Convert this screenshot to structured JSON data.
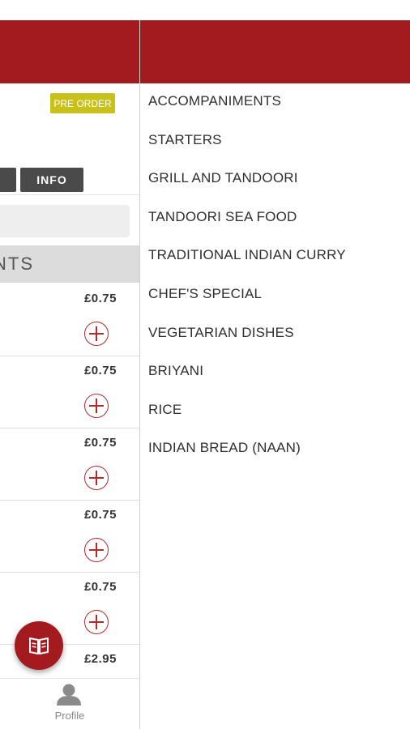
{
  "left_panel": {
    "badge": "PRE ORDER",
    "tabs": {
      "left_partial": "",
      "info": "INFO"
    },
    "search": {
      "placeholder": ""
    },
    "section_header": "NTS",
    "items": [
      {
        "price": "£0.75"
      },
      {
        "price": "£0.75"
      },
      {
        "price": "£0.75"
      },
      {
        "price": "£0.75"
      },
      {
        "price": "£0.75"
      },
      {
        "price": "£2.95"
      }
    ],
    "bottom_nav": {
      "profile_label": "Profile"
    },
    "fab_icon": "menu-book-icon"
  },
  "drawer": {
    "categories": [
      "ACCOMPANIMENTS",
      "STARTERS",
      "GRILL AND TANDOORI",
      "TANDOORI SEA FOOD",
      "TRADITIONAL INDIAN CURRY",
      "CHEF'S SPECIAL",
      "VEGETARIAN DISHES",
      "BRIYANI",
      "RICE",
      "INDIAN BREAD (NAAN)"
    ]
  },
  "colors": {
    "brand_red": "#a31b1e",
    "badge_yellow": "#c8c11b",
    "tab_dark": "#4a4a4a"
  }
}
